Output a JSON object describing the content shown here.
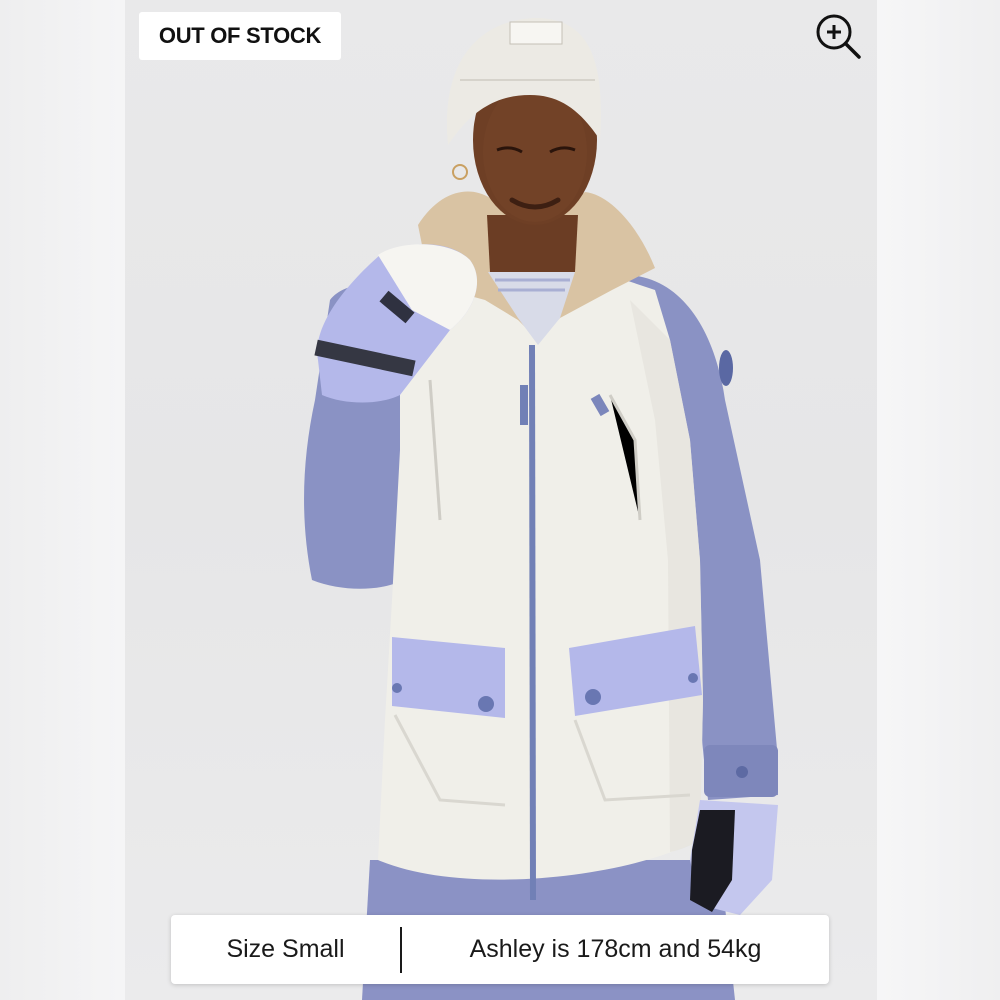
{
  "product": {
    "stock_badge": "OUT OF STOCK",
    "zoom_icon": "zoom-in-icon",
    "photo_alt": "Model wearing a white and periwinkle winter jacket with a sherpa collar, white beanie and mittens"
  },
  "model_info": {
    "size": "Size Small",
    "measurements": "Ashley is 178cm and 54kg"
  },
  "colors": {
    "jacket_white": "#f0efe9",
    "jacket_blue": "#8a92c4",
    "pocket_lavender": "#b4b8ea",
    "collar_tan": "#d9c3a3",
    "skin": "#6b3d24",
    "background": "#e7e7e8"
  }
}
